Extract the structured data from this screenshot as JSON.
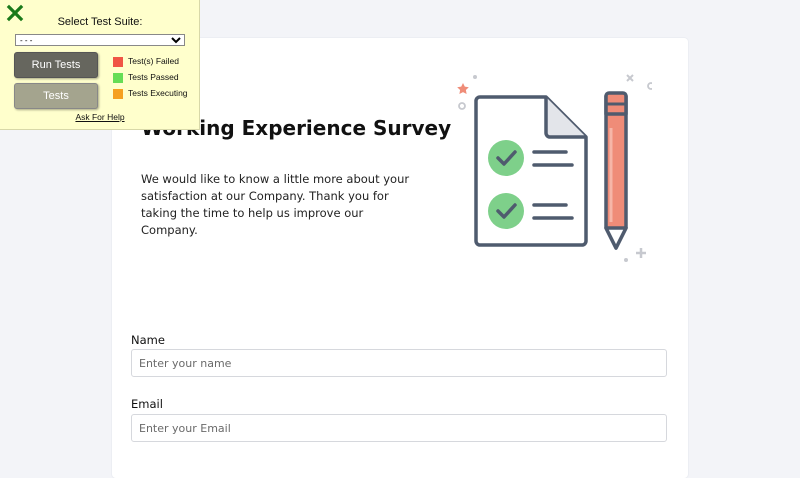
{
  "survey": {
    "title": "Working Experience Survey",
    "description": "We would like to know a little more about your satisfaction at our Company. Thank you for taking the time to help us improve our Company.",
    "fields": {
      "name_label": "Name",
      "name_placeholder": "Enter your name",
      "email_label": "Email",
      "email_placeholder": "Enter your Email"
    }
  },
  "test_panel": {
    "title": "Select Test Suite:",
    "suite_selected": "- - -",
    "run_button": "Run Tests",
    "tests_button": "Tests",
    "legend": {
      "failed": "Test(s) Failed",
      "passed": "Tests Passed",
      "executing": "Tests Executing"
    },
    "help_link": "Ask For Help"
  },
  "colors": {
    "failed": "#f05545",
    "passed": "#66dd55",
    "executing": "#f5a020",
    "close_icon": "#1a7a1a",
    "check_circle": "#7ed08a",
    "pencil": "#ef8c78",
    "outline": "#4f5b6e"
  },
  "icons": [
    "close-icon",
    "survey-document-icon",
    "checkmark-icon",
    "pencil-icon"
  ]
}
